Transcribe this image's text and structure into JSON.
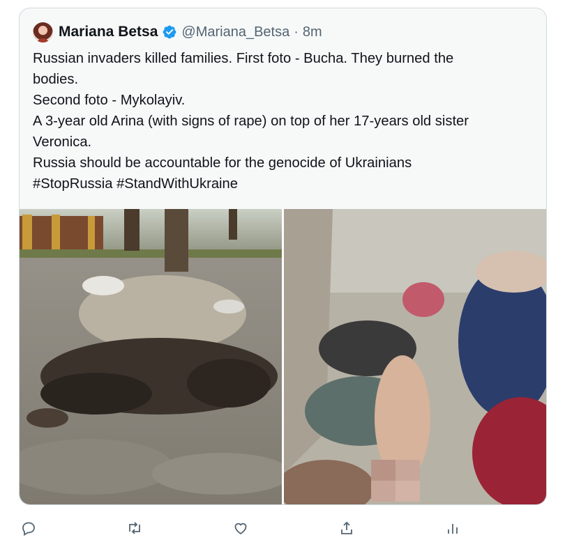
{
  "tweet": {
    "display_name": "Mariana Betsa",
    "handle": "@Mariana_Betsa",
    "separator": "·",
    "time": "8m",
    "verified": true,
    "lines": [
      "Russian invaders killed families. First foto - Bucha. They burned the",
      "bodies.",
      "Second foto - Mykolayiv.",
      "A 3-year old Arina (with signs of rape) on top of her 17-years old sister",
      "Veronica.",
      "Russia should be accountable for the genocide of Ukrainians",
      "#StopRussia #StandWithUkraine"
    ]
  },
  "media": [
    {
      "icon": "photo"
    },
    {
      "icon": "photo"
    }
  ],
  "actions": [
    {
      "icon": "reply-icon"
    },
    {
      "icon": "retweet-icon"
    },
    {
      "icon": "like-icon"
    },
    {
      "icon": "share-icon"
    },
    {
      "icon": "analytics-icon"
    }
  ],
  "colors": {
    "card_bg": "#f7f9f9",
    "border": "#cfd9de",
    "verified": "#1d9bf0",
    "secondary_text": "#536471"
  }
}
